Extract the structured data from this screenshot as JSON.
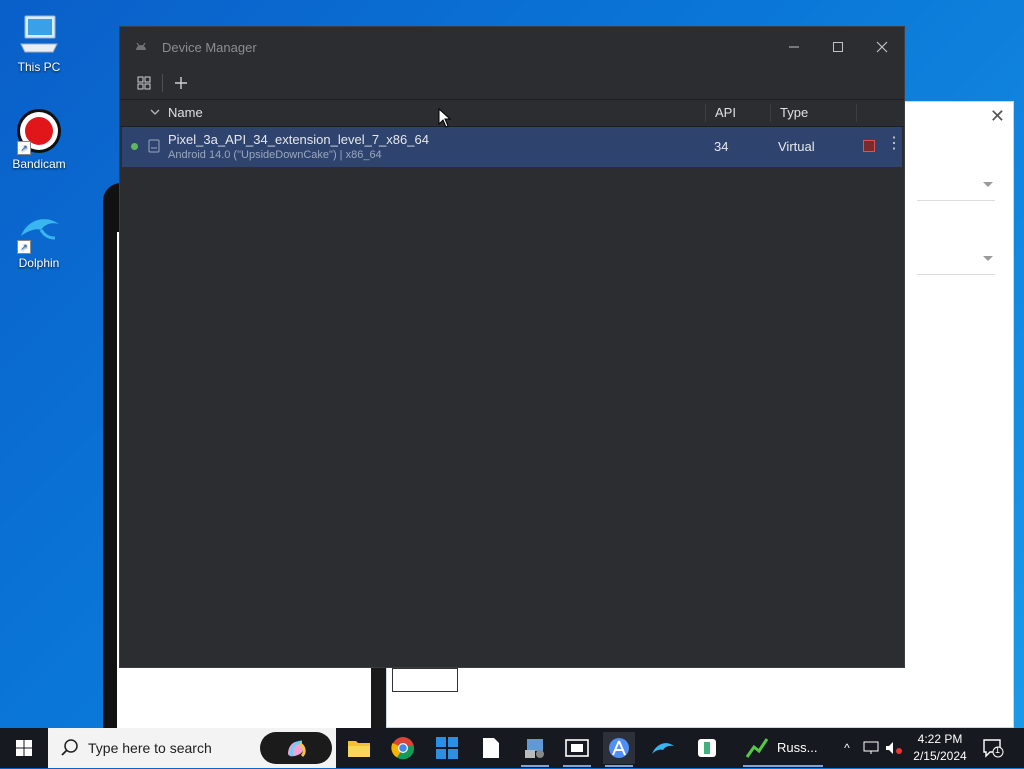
{
  "desktop": {
    "icons": [
      {
        "label": "This PC",
        "icon": "computer-icon"
      },
      {
        "label": "Bandicam",
        "icon": "bandicam-icon"
      },
      {
        "label": "Dolphin",
        "icon": "dolphin-icon"
      }
    ]
  },
  "window": {
    "title": "Device Manager",
    "controls": [
      "minimize",
      "maximize",
      "close"
    ]
  },
  "toolbar": {
    "buttons": [
      "device-grid-icon",
      "add-icon"
    ]
  },
  "table": {
    "headers": {
      "name": "Name",
      "api": "API",
      "type": "Type"
    },
    "rows": [
      {
        "status": "online",
        "name": "Pixel_3a_API_34_extension_level_7_x86_64",
        "subtitle": "Android 14.0 (\"UpsideDownCake\") | x86_64",
        "api": "34",
        "type": "Virtual"
      }
    ]
  },
  "taskbar": {
    "search_placeholder": "Type here to search",
    "running_label": "Russ...",
    "time": "4:22 PM",
    "date": "2/15/2024",
    "notification_count": "1"
  },
  "colors": {
    "window_bg": "#2b2d30",
    "selected_row": "#2e436e",
    "status_online": "#5fb85f",
    "desktop_blue": "#0a78d8"
  }
}
